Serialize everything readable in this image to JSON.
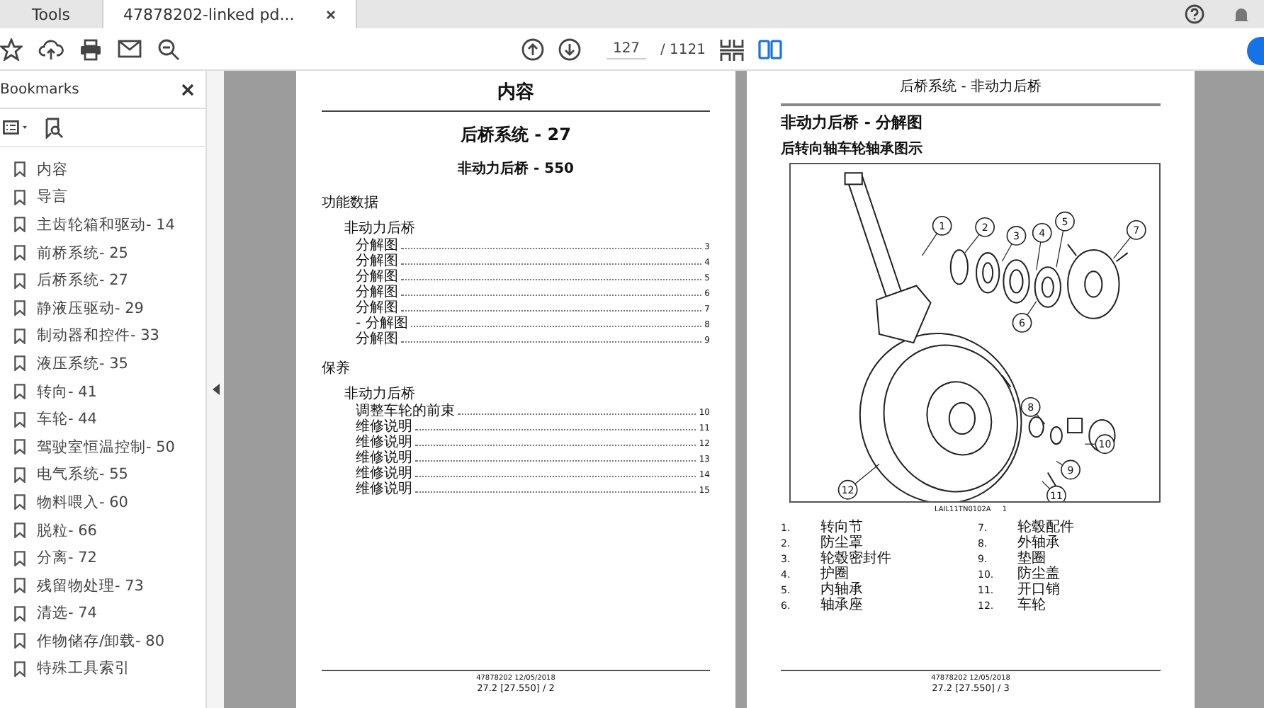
{
  "tabs": [
    {
      "label": "Tools",
      "selected": false
    },
    {
      "label": "47878202-linked pd...",
      "selected": true
    }
  ],
  "toolbar": {
    "page_number": "127",
    "page_total": "/ 1121",
    "view_modes": [
      {
        "kind": "scroll",
        "selected": false
      },
      {
        "kind": "two-page",
        "selected": true
      }
    ]
  },
  "sidebar": {
    "title": "Bookmarks",
    "items": [
      {
        "label": "内容"
      },
      {
        "label": "导言"
      },
      {
        "label": "主齿轮箱和驱动- 14"
      },
      {
        "label": "前桥系统- 25"
      },
      {
        "label": "后桥系统- 27"
      },
      {
        "label": "静液压驱动- 29"
      },
      {
        "label": "制动器和控件- 33"
      },
      {
        "label": "液压系统- 35"
      },
      {
        "label": "转向- 41"
      },
      {
        "label": "车轮- 44"
      },
      {
        "label": "驾驶室恒温控制- 50"
      },
      {
        "label": "电气系统- 55"
      },
      {
        "label": "物料喂入- 60"
      },
      {
        "label": "脱粒- 66"
      },
      {
        "label": "分离- 72"
      },
      {
        "label": "残留物处理- 73"
      },
      {
        "label": "清选- 74"
      },
      {
        "label": "作物储存/卸载- 80"
      },
      {
        "label": "特殊工具索引"
      }
    ]
  },
  "pages": [
    {
      "kind": "contents",
      "title": "内容",
      "subtitle": "后桥系统 - 27",
      "section": "非动力后桥 - 550",
      "groups": [
        {
          "heading": "功能数据",
          "subheading": "非动力后桥",
          "entries": [
            {
              "label": "分解图",
              "page": "3"
            },
            {
              "label": "分解图",
              "page": "4"
            },
            {
              "label": "分解图",
              "page": "5"
            },
            {
              "label": "分解图",
              "page": "6"
            },
            {
              "label": "分解图",
              "page": "7"
            },
            {
              "label": "- 分解图",
              "page": "8"
            },
            {
              "label": "分解图",
              "page": "9"
            }
          ]
        },
        {
          "heading": "保养",
          "subheading": "非动力后桥",
          "entries": [
            {
              "label": "调整车轮的前束",
              "page": "10"
            },
            {
              "label": "维修说明",
              "page": "11"
            },
            {
              "label": "维修说明",
              "page": "12"
            },
            {
              "label": "维修说明",
              "page": "13"
            },
            {
              "label": "维修说明",
              "page": "14"
            },
            {
              "label": "维修说明",
              "page": "15"
            }
          ]
        }
      ],
      "footer": {
        "line_1": "47878202 12/05/2018",
        "line_2": "27.2 [27.550] / 2"
      }
    },
    {
      "kind": "diagram",
      "running_head": "后桥系统 - 非动力后桥",
      "title": "非动力后桥 - 分解图",
      "subtitle": "后转向轴车轮轴承图示",
      "callouts": [
        "1",
        "2",
        "3",
        "4",
        "5",
        "6",
        "7",
        "8",
        "9",
        "10",
        "11",
        "12"
      ],
      "figure_code": "LAIL11TN0102A",
      "figure_number": "1",
      "legend": [
        {
          "number": "1.",
          "label": "转向节"
        },
        {
          "number": "2.",
          "label": "防尘罩"
        },
        {
          "number": "3.",
          "label": "轮毂密封件"
        },
        {
          "number": "4.",
          "label": "护圈"
        },
        {
          "number": "5.",
          "label": "内轴承"
        },
        {
          "number": "6.",
          "label": "轴承座"
        },
        {
          "number": "7.",
          "label": "轮毂配件"
        },
        {
          "number": "8.",
          "label": "外轴承"
        },
        {
          "number": "9.",
          "label": "垫圈"
        },
        {
          "number": "10.",
          "label": "防尘盖"
        },
        {
          "number": "11.",
          "label": "开口销"
        },
        {
          "number": "12.",
          "label": "车轮"
        }
      ],
      "footer": {
        "line_1": "47878202 12/05/2018",
        "line_2": "27.2 [27.550] / 3"
      }
    }
  ]
}
